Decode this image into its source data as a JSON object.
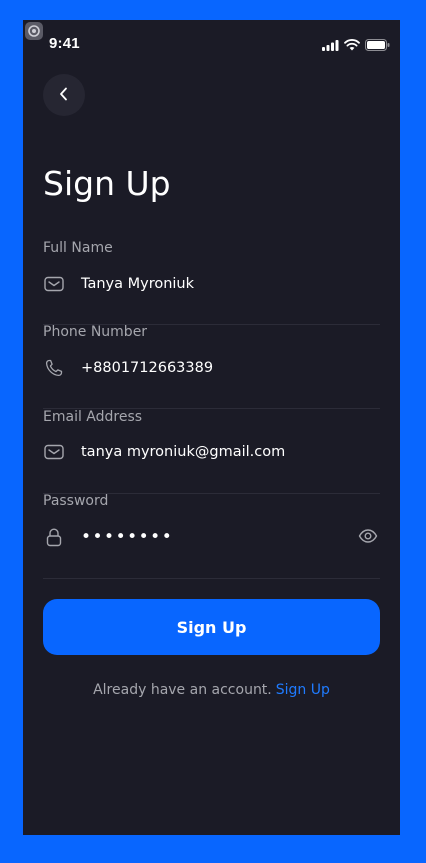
{
  "status_bar": {
    "time": "9:41"
  },
  "page": {
    "title": "Sign Up"
  },
  "form": {
    "full_name": {
      "label": "Full Name",
      "value": "Tanya Myroniuk",
      "icon": "mail-icon"
    },
    "phone": {
      "label": "Phone Number",
      "value": "+8801712663389",
      "icon": "phone-icon"
    },
    "email": {
      "label": "Email Address",
      "value": "tanya myroniuk@gmail.com",
      "icon": "mail-icon"
    },
    "password": {
      "label": "Password",
      "value": "••••••••",
      "icon": "lock-icon"
    }
  },
  "actions": {
    "submit_label": "Sign Up"
  },
  "footer": {
    "prompt": "Already have an account.",
    "link": "Sign Up"
  },
  "colors": {
    "background": "#1b1b26",
    "accent": "#0866ff",
    "muted": "#a5a6ad",
    "link": "#1f7bff"
  }
}
